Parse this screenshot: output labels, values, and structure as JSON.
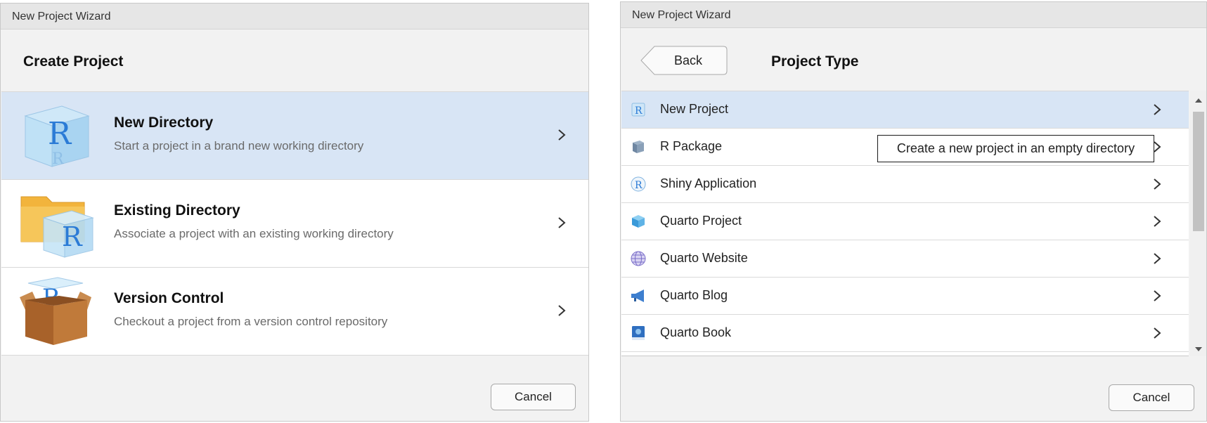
{
  "left_dialog": {
    "window_title": "New Project Wizard",
    "heading": "Create Project",
    "options": [
      {
        "title": "New Directory",
        "subtitle": "Start a project in a brand new working directory",
        "icon": "r-cube-icon"
      },
      {
        "title": "Existing Directory",
        "subtitle": "Associate a project with an existing working directory",
        "icon": "folder-r-icon"
      },
      {
        "title": "Version Control",
        "subtitle": "Checkout a project from a version control repository",
        "icon": "box-r-icon"
      }
    ],
    "cancel_label": "Cancel"
  },
  "right_dialog": {
    "window_title": "New Project Wizard",
    "back_label": "Back",
    "heading": "Project Type",
    "items": [
      {
        "label": "New Project",
        "icon": "r-project-icon"
      },
      {
        "label": "R Package",
        "icon": "package-icon"
      },
      {
        "label": "Shiny Application",
        "icon": "shiny-icon"
      },
      {
        "label": "Quarto Project",
        "icon": "quarto-project-icon"
      },
      {
        "label": "Quarto Website",
        "icon": "globe-icon"
      },
      {
        "label": "Quarto Blog",
        "icon": "megaphone-icon"
      },
      {
        "label": "Quarto Book",
        "icon": "book-icon"
      }
    ],
    "tooltip": "Create a new project in an empty directory",
    "cancel_label": "Cancel"
  },
  "colors": {
    "selected_row": "#d8e5f5",
    "dialog_bg": "#f2f2f2",
    "titlebar_bg": "#e6e6e6",
    "r_blue": "#2b7bd6"
  }
}
